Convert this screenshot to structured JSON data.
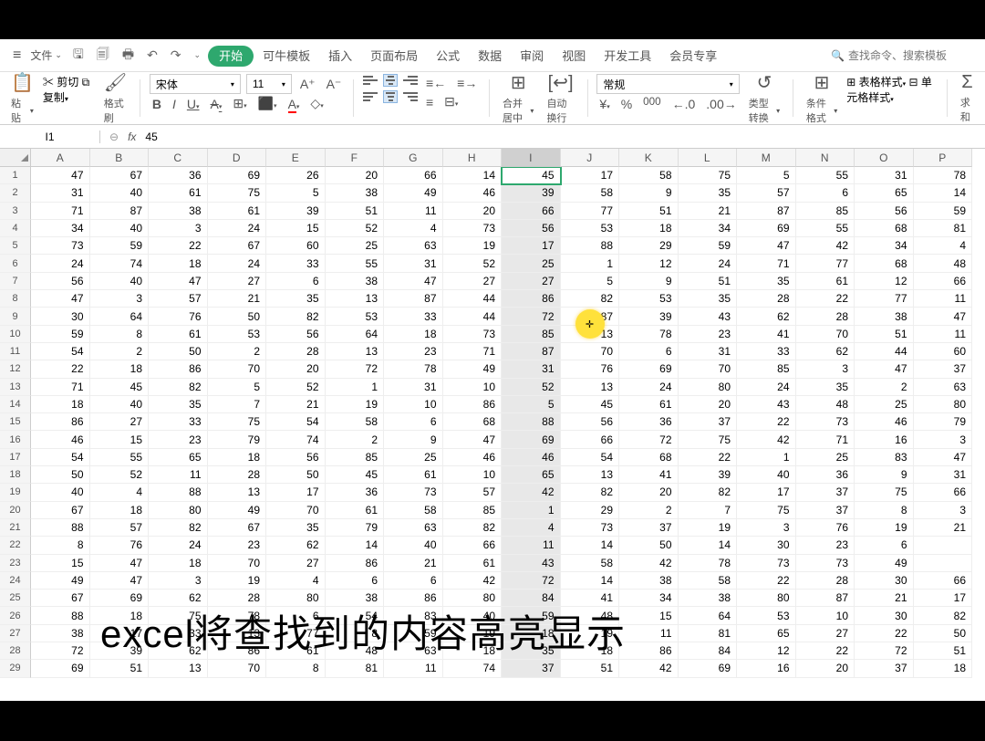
{
  "menubar": {
    "file": "文件",
    "items": [
      "开始",
      "可牛模板",
      "插入",
      "页面布局",
      "公式",
      "数据",
      "审阅",
      "视图",
      "开发工具",
      "会员专享"
    ],
    "active_index": 0,
    "search_placeholder": "查找命令、搜索模板"
  },
  "toolbar": {
    "paste": "粘贴",
    "cut": "剪切",
    "copy": "复制",
    "format_painter": "格式刷",
    "font_name": "宋体",
    "font_size": "11",
    "merge": "合并居中",
    "wrap": "自动换行",
    "number_format": "常规",
    "type_convert": "类型转换",
    "cond_format": "条件格式",
    "table_style": "表格样式",
    "cell_style": "单元格样式",
    "sum": "求和"
  },
  "formula_bar": {
    "cell_ref": "I1",
    "value": "45"
  },
  "columns": [
    "A",
    "B",
    "C",
    "D",
    "E",
    "F",
    "G",
    "H",
    "I",
    "J",
    "K",
    "L",
    "M",
    "N",
    "O",
    "P"
  ],
  "selected_col_index": 8,
  "active_cell": {
    "row": 0,
    "col": 8
  },
  "highlight_pos": {
    "row": 8,
    "col": 9
  },
  "overlay_text": "excel将查找到的内容高亮显示",
  "rows": [
    [
      47,
      67,
      36,
      69,
      26,
      20,
      66,
      14,
      45,
      17,
      58,
      75,
      5,
      55,
      31,
      78
    ],
    [
      31,
      40,
      61,
      75,
      5,
      38,
      49,
      46,
      39,
      58,
      9,
      35,
      57,
      6,
      65,
      14
    ],
    [
      71,
      87,
      38,
      61,
      39,
      51,
      11,
      20,
      66,
      77,
      51,
      21,
      87,
      85,
      56,
      59
    ],
    [
      34,
      40,
      3,
      24,
      15,
      52,
      4,
      73,
      56,
      53,
      18,
      34,
      69,
      55,
      68,
      81
    ],
    [
      73,
      59,
      22,
      67,
      60,
      25,
      63,
      19,
      17,
      88,
      29,
      59,
      47,
      42,
      34,
      4
    ],
    [
      24,
      74,
      18,
      24,
      33,
      55,
      31,
      52,
      25,
      1,
      12,
      24,
      71,
      77,
      68,
      48
    ],
    [
      56,
      40,
      47,
      27,
      6,
      38,
      47,
      27,
      27,
      5,
      9,
      51,
      35,
      61,
      12,
      66
    ],
    [
      47,
      3,
      57,
      21,
      35,
      13,
      87,
      44,
      86,
      82,
      53,
      35,
      28,
      22,
      77,
      11
    ],
    [
      30,
      64,
      76,
      50,
      82,
      53,
      33,
      44,
      72,
      87,
      39,
      43,
      62,
      28,
      38,
      47
    ],
    [
      59,
      8,
      61,
      53,
      56,
      64,
      18,
      73,
      85,
      13,
      78,
      23,
      41,
      70,
      51,
      11
    ],
    [
      54,
      2,
      50,
      2,
      28,
      13,
      23,
      71,
      87,
      70,
      6,
      31,
      33,
      62,
      44,
      60
    ],
    [
      22,
      18,
      86,
      70,
      20,
      72,
      78,
      49,
      31,
      76,
      69,
      70,
      85,
      3,
      47,
      37
    ],
    [
      71,
      45,
      82,
      5,
      52,
      1,
      31,
      10,
      52,
      13,
      24,
      80,
      24,
      35,
      2,
      63
    ],
    [
      18,
      40,
      35,
      7,
      21,
      19,
      10,
      86,
      5,
      45,
      61,
      20,
      43,
      48,
      25,
      80
    ],
    [
      86,
      27,
      33,
      75,
      54,
      58,
      6,
      68,
      88,
      56,
      36,
      37,
      22,
      73,
      46,
      79
    ],
    [
      46,
      15,
      23,
      79,
      74,
      2,
      9,
      47,
      69,
      66,
      72,
      75,
      42,
      71,
      16,
      3
    ],
    [
      54,
      55,
      65,
      18,
      56,
      85,
      25,
      46,
      46,
      54,
      68,
      22,
      1,
      25,
      83,
      47
    ],
    [
      50,
      52,
      11,
      28,
      50,
      45,
      61,
      10,
      65,
      13,
      41,
      39,
      40,
      36,
      9,
      31
    ],
    [
      40,
      4,
      88,
      13,
      17,
      36,
      73,
      57,
      42,
      82,
      20,
      82,
      17,
      37,
      75,
      66
    ],
    [
      67,
      18,
      80,
      49,
      70,
      61,
      58,
      85,
      1,
      29,
      2,
      7,
      75,
      37,
      8,
      3
    ],
    [
      88,
      57,
      82,
      67,
      35,
      79,
      63,
      82,
      4,
      73,
      37,
      19,
      3,
      76,
      19,
      21
    ],
    [
      8,
      76,
      24,
      23,
      62,
      14,
      40,
      66,
      11,
      14,
      50,
      14,
      30,
      23,
      6,
      ""
    ],
    [
      15,
      47,
      18,
      70,
      27,
      86,
      21,
      61,
      43,
      58,
      42,
      78,
      73,
      73,
      49,
      ""
    ],
    [
      49,
      47,
      3,
      19,
      4,
      6,
      6,
      42,
      72,
      14,
      38,
      58,
      22,
      28,
      30,
      66
    ],
    [
      67,
      69,
      62,
      28,
      80,
      38,
      86,
      80,
      84,
      41,
      34,
      38,
      80,
      87,
      21,
      17
    ],
    [
      88,
      18,
      75,
      78,
      6,
      54,
      83,
      40,
      59,
      48,
      15,
      64,
      53,
      10,
      30,
      82
    ],
    [
      38,
      17,
      33,
      13,
      77,
      8,
      59,
      19,
      18,
      19,
      11,
      81,
      65,
      27,
      22,
      50
    ],
    [
      72,
      39,
      62,
      86,
      61,
      48,
      63,
      18,
      35,
      18,
      86,
      84,
      12,
      22,
      72,
      51
    ],
    [
      69,
      51,
      13,
      70,
      8,
      81,
      11,
      74,
      37,
      51,
      42,
      69,
      16,
      20,
      37,
      18
    ]
  ]
}
